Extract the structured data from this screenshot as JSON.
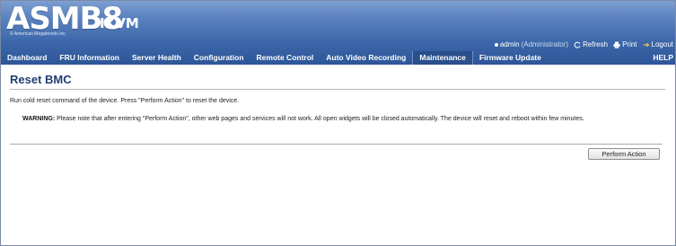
{
  "header": {
    "logo_main": "ASMB8",
    "logo_sub": "IKVM",
    "copyright": "© American Megatrends Inc.",
    "user": "admin",
    "role": "(Administrator)",
    "refresh_label": "Refresh",
    "print_label": "Print",
    "logout_label": "Logout"
  },
  "nav": {
    "items": [
      {
        "label": "Dashboard"
      },
      {
        "label": "FRU Information"
      },
      {
        "label": "Server Health"
      },
      {
        "label": "Configuration"
      },
      {
        "label": "Remote Control"
      },
      {
        "label": "Auto Video Recording"
      },
      {
        "label": "Maintenance"
      },
      {
        "label": "Firmware Update"
      }
    ],
    "active": "Maintenance",
    "help_label": "HELP"
  },
  "page": {
    "title": "Reset BMC",
    "description": "Run cold reset command of the device. Press \"Perform Action\" to reset the device.",
    "warning_label": "WARNING:",
    "warning_text": " Please note that after entering \"Perform Action\", other web pages and services will not work. All open widgets will be closed automatically. The device will reset and reboot within few minutes.",
    "button_label": "Perform Action"
  },
  "colors": {
    "banner": "#5d84c0",
    "navbar": "#2d5698",
    "title": "#1f3f73"
  }
}
